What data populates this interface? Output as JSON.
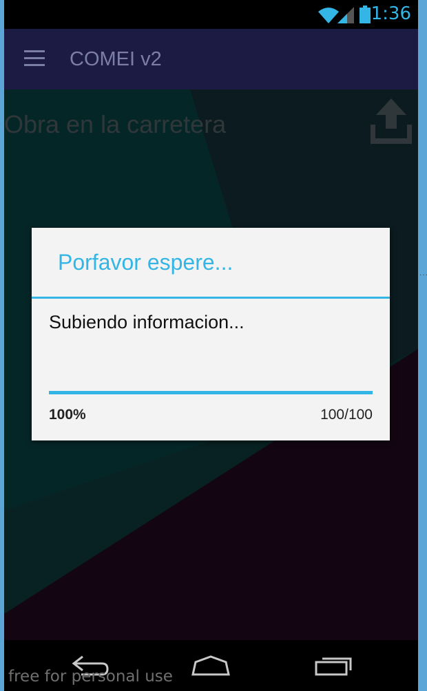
{
  "status_bar": {
    "time": "1:36",
    "wifi_icon": "wifi-icon",
    "signal_icon": "signal-icon",
    "battery_icon": "battery-icon",
    "accent": "#33b5e5"
  },
  "toolbar": {
    "title": "COMEI v2",
    "menu_icon": "menu-icon",
    "background": "#1b1b44"
  },
  "page": {
    "heading": "Obra en la carretera",
    "upload_icon": "upload-icon"
  },
  "dialog": {
    "title": "Porfavor espere...",
    "message": "Subiendo informacion...",
    "progress": {
      "fraction": 1.0,
      "percent_label": "100%",
      "count_label": "100/100"
    },
    "accent": "#33b5e5"
  },
  "nav_bar": {
    "back_icon": "back-icon",
    "home_icon": "home-icon",
    "recents_icon": "recents-icon"
  },
  "watermark": "free for personal use"
}
